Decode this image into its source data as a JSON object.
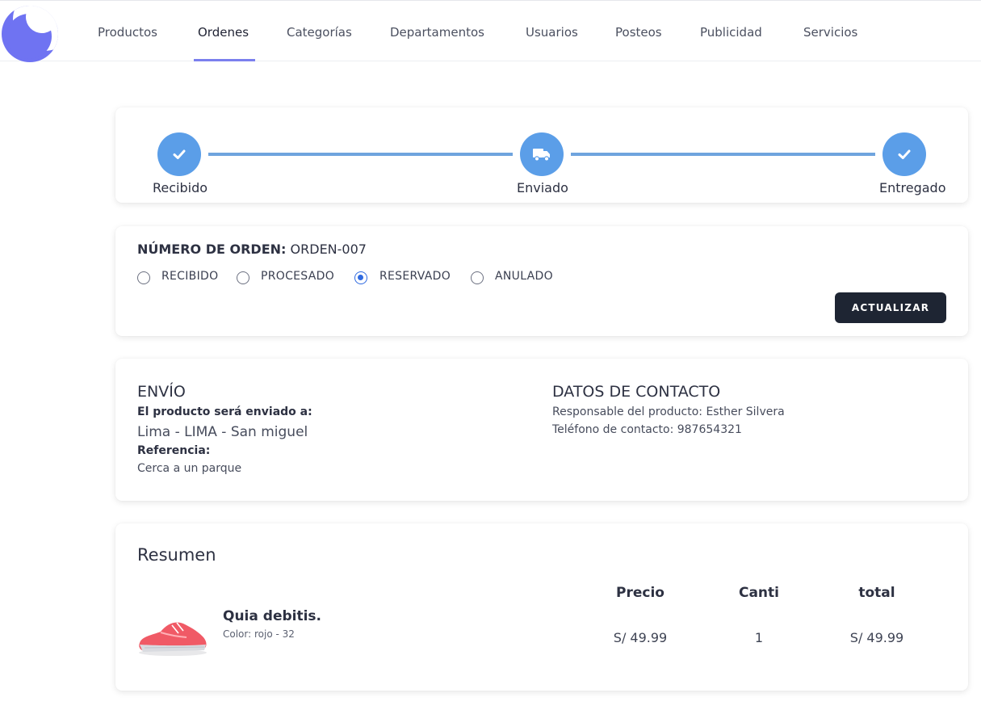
{
  "nav": {
    "items": [
      "Productos",
      "Ordenes",
      "Categorías",
      "Departamentos",
      "Usuarios",
      "Posteos",
      "Publicidad",
      "Servicios"
    ],
    "active": "Ordenes"
  },
  "steps": [
    {
      "label": "Recibido",
      "icon": "check-icon"
    },
    {
      "label": "Enviado",
      "icon": "truck-icon"
    },
    {
      "label": "Entregado",
      "icon": "check-icon"
    }
  ],
  "order": {
    "number_label": "NÚMERO DE ORDEN:",
    "number_value": "ORDEN-007",
    "statuses": [
      "RECIBIDO",
      "PROCESADO",
      "RESERVADO",
      "ANULADO"
    ],
    "selected_status": "RESERVADO",
    "update_button": "ACTUALIZAR"
  },
  "shipping": {
    "title": "ENVÍO",
    "sent_to_label": "El producto será enviado a:",
    "address": "Lima - LIMA - San miguel",
    "reference_label": "Referencia:",
    "reference": "Cerca a un parque"
  },
  "contact": {
    "title": "DATOS DE CONTACTO",
    "responsible": "Responsable del producto: Esther Silvera",
    "phone": "Teléfono de contacto: 987654321"
  },
  "summary": {
    "title": "Resumen",
    "headers": {
      "price": "Precio",
      "qty": "Canti",
      "total": "total"
    },
    "items": [
      {
        "name": "Quia debitis.",
        "variant": "Color: rojo - 32",
        "price": "S/ 49.99",
        "qty": "1",
        "total": "S/ 49.99"
      }
    ]
  },
  "colors": {
    "accent": "#5b9ee8",
    "brand": "#6f73f2",
    "button": "#1e2533",
    "radio": "#2f6ae0"
  }
}
